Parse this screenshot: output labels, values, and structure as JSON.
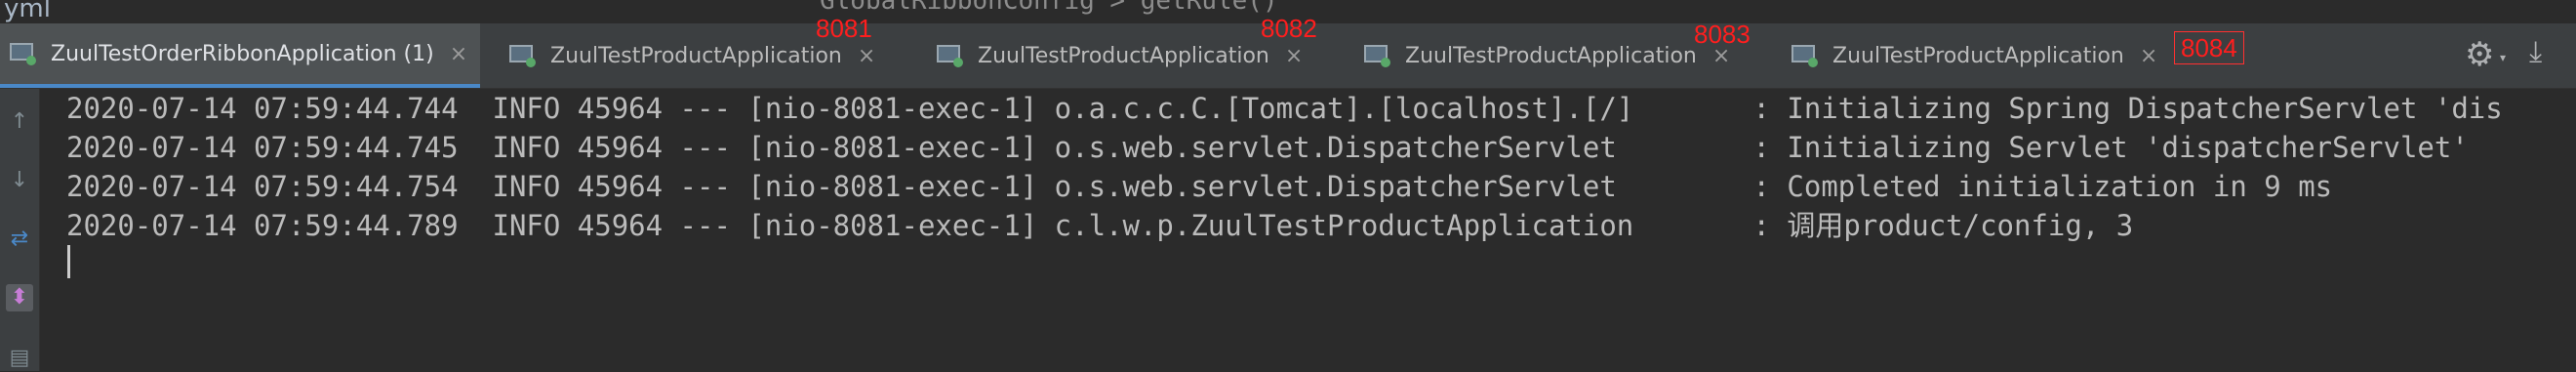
{
  "editor_strip": {
    "file_fragment": "yml",
    "breadcrumb": "GlobalRibbonConfig  >  getRule()"
  },
  "tabs": [
    {
      "label": "ZuulTestOrderRibbonApplication (1)",
      "close": "×",
      "active": true
    },
    {
      "label": "ZuulTestProductApplication",
      "close": "×",
      "active": false
    },
    {
      "label": "ZuulTestProductApplication",
      "close": "×",
      "active": false
    },
    {
      "label": "ZuulTestProductApplication",
      "close": "×",
      "active": false
    },
    {
      "label": "ZuulTestProductApplication",
      "close": "×",
      "active": false
    }
  ],
  "port_annotations": [
    "8081",
    "8082",
    "8083",
    "8084"
  ],
  "toolbar": {
    "settings_glyph": "⚙",
    "settings_caret": "▾",
    "download_glyph": "⤓"
  },
  "left_icons": {
    "up": "↑",
    "down": "↓",
    "rerun": "⇄",
    "pin": "⬍",
    "print": "▤"
  },
  "console_lines": [
    "2020-07-14 07:59:44.744  INFO 45964 --- [nio-8081-exec-1] o.a.c.c.C.[Tomcat].[localhost].[/]       : Initializing Spring DispatcherServlet 'dis",
    "2020-07-14 07:59:44.745  INFO 45964 --- [nio-8081-exec-1] o.s.web.servlet.DispatcherServlet        : Initializing Servlet 'dispatcherServlet'",
    "2020-07-14 07:59:44.754  INFO 45964 --- [nio-8081-exec-1] o.s.web.servlet.DispatcherServlet        : Completed initialization in 9 ms",
    "2020-07-14 07:59:44.789  INFO 45964 --- [nio-8081-exec-1] c.l.w.p.ZuulTestProductApplication       : 调用product/config, 3"
  ],
  "colors": {
    "accent": "#4a88c7",
    "annotation": "#ff1e1e",
    "running": "#59a869"
  }
}
